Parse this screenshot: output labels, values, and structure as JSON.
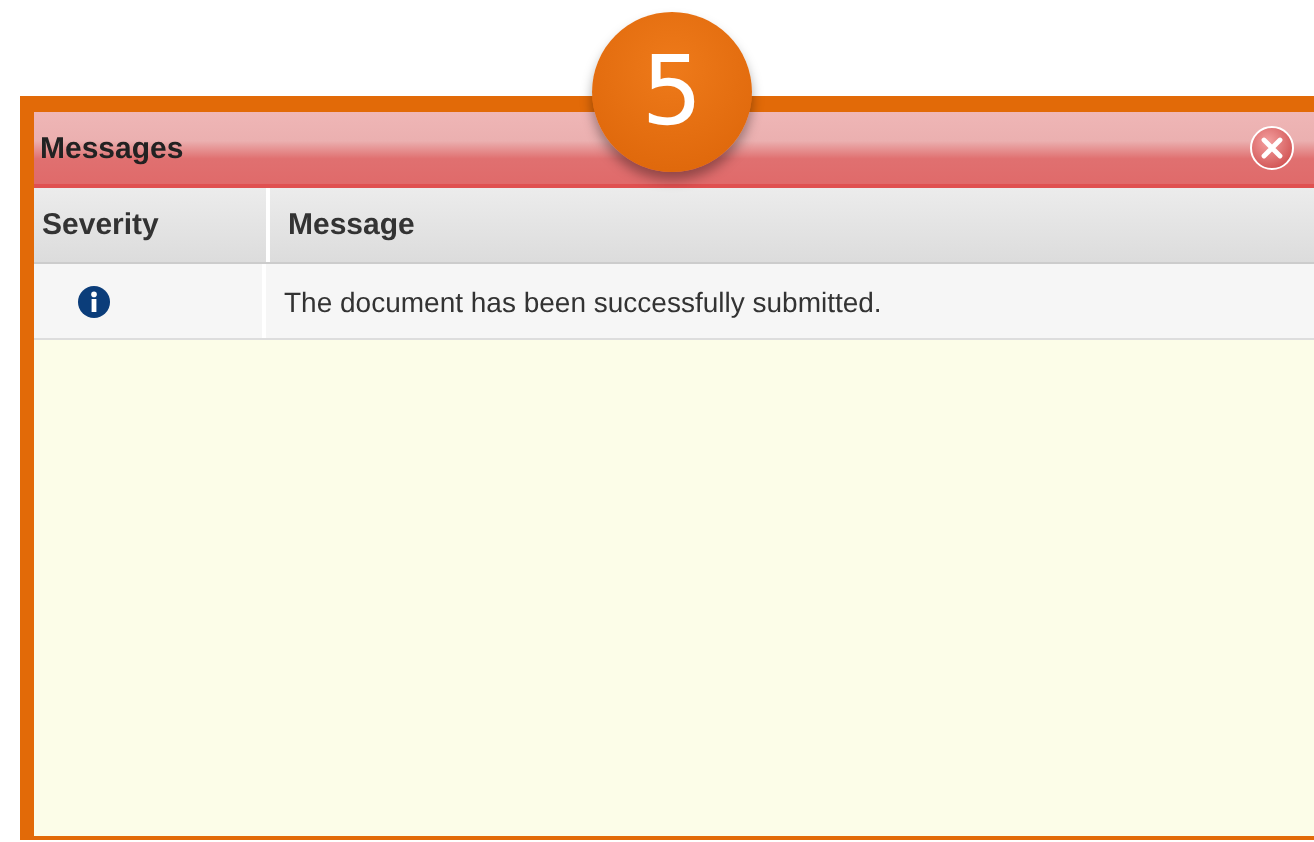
{
  "step_badge": "5",
  "panel": {
    "title": "Messages",
    "columns": [
      "Severity",
      "Message"
    ],
    "rows": [
      {
        "kind": "info",
        "message": "The document has been successfully submitted."
      }
    ]
  }
}
